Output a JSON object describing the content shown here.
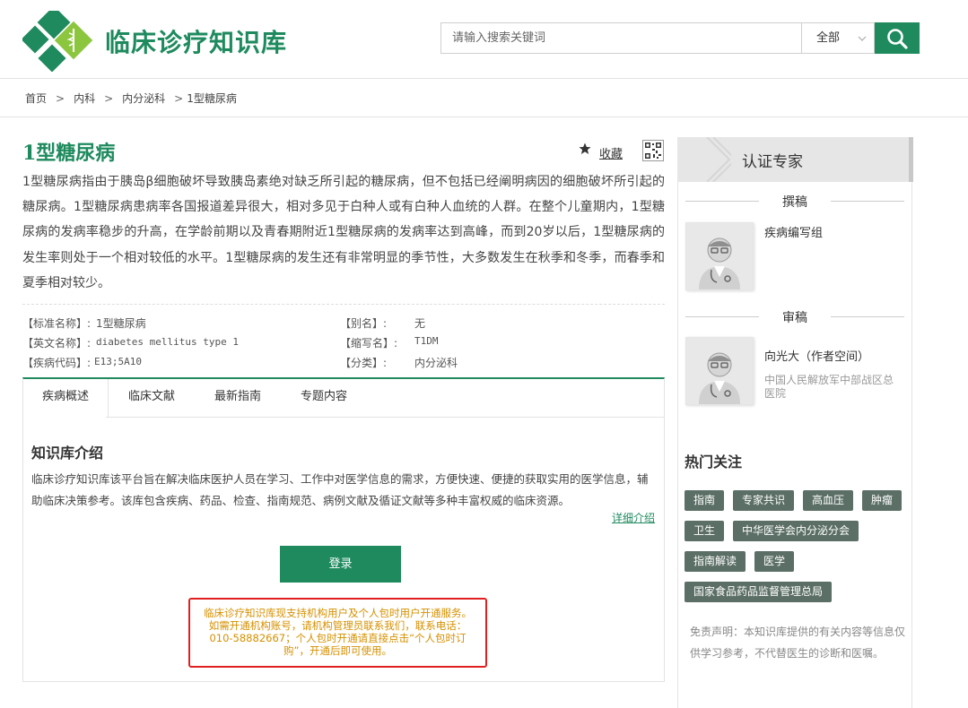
{
  "header": {
    "site_title": "临床诊疗知识库",
    "search_placeholder": "请输入搜索关键词",
    "search_scope": "全部",
    "brand_color": "#1e8a5e"
  },
  "breadcrumb": [
    "首页",
    "内科",
    "内分泌科",
    "1型糖尿病"
  ],
  "disease": {
    "title": "1型糖尿病",
    "favorite_label": "收藏",
    "summary": "1型糖尿病指由于胰岛β细胞破坏导致胰岛素绝对缺乏所引起的糖尿病，但不包括已经阐明病因的细胞破坏所引起的糖尿病。1型糖尿病患病率各国报道差异很大，相对多见于白种人或有白种人血统的人群。在整个儿童期内，1型糖尿病的发病率稳步的升高，在学龄前期以及青春期附近1型糖尿病的发病率达到高峰，而到20岁以后，1型糖尿病的发生率则处于一个相对较低的水平。1型糖尿病的发生还有非常明显的季节性，大多数发生在秋季和冬季，而春季和夏季相对较少。",
    "meta": {
      "std_name_label": "【标准名称】:",
      "std_name": "1型糖尿病",
      "alias_label": "【别名】:",
      "alias": "无",
      "en_name_label": "【英文名称】:",
      "en_name": "diabetes mellitus type 1",
      "abbr_label": "【缩写名】:",
      "abbr": "T1DM",
      "code_label": "【疾病代码】:",
      "code": "E13;5A10",
      "category_label": "【分类】:",
      "category": "内分泌科"
    }
  },
  "tabs": [
    "疾病概述",
    "临床文献",
    "最新指南",
    "专题内容"
  ],
  "intro": {
    "title": "知识库介绍",
    "text": "临床诊疗知识库该平台旨在解决临床医护人员在学习、工作中对医学信息的需求，方便快速、便捷的获取实用的医学信息，辅助临床决策参考。该库包含疾病、药品、检查、指南规范、病例文献及循证文献等多种丰富权威的临床资源。",
    "detail_link": "详细介绍",
    "login_label": "登录",
    "notice": "临床诊疗知识库现支持机构用户及个人包时用户开通服务。如需开通机构账号，请机构管理员联系我们，联系电话：010-58882667；个人包时开通请直接点击“个人包时订购”，开通后即可使用。"
  },
  "sidebar": {
    "title": "认证专家",
    "author_section": "撰稿",
    "author_name": "疾病编写组",
    "reviewer_section": "审稿",
    "reviewer_name": "向光大（作者空间）",
    "reviewer_org": "中国人民解放军中部战区总医院",
    "hot_title": "热门关注",
    "tags": [
      "指南",
      "专家共识",
      "高血压",
      "肿瘤",
      "卫生",
      "中华医学会内分泌分会",
      "指南解读",
      "医学",
      "国家食品药品监督管理总局"
    ],
    "disclaimer": "免责声明：本知识库提供的有关内容等信息仅供学习参考，不代替医生的诊断和医嘱。"
  }
}
